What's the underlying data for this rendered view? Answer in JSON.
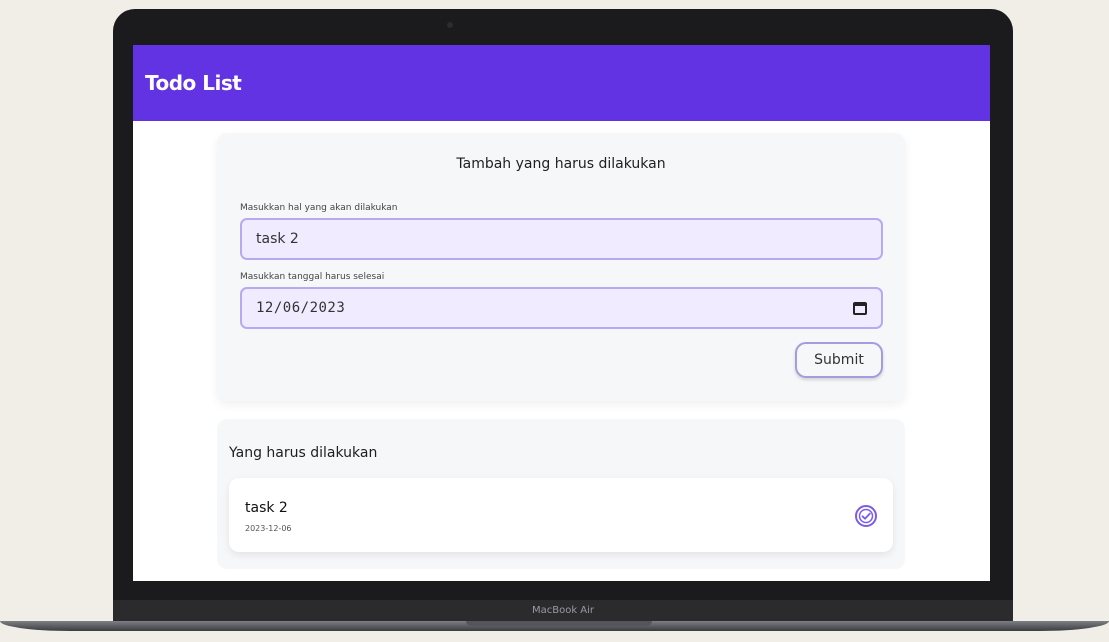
{
  "app": {
    "title": "Todo List"
  },
  "form": {
    "heading": "Tambah yang harus dilakukan",
    "task_label": "Masukkan hal yang akan dilakukan",
    "task_value": "task 2",
    "date_label": "Masukkan tanggal harus selesai",
    "date_value": "12/06/2023",
    "submit_label": "Submit"
  },
  "todo_list": {
    "heading": "Yang harus dilakukan",
    "items": [
      {
        "title": "task 2",
        "date": "2023-12-06"
      }
    ]
  },
  "device": {
    "label": "MacBook Air"
  },
  "colors": {
    "accent": "#6233e3",
    "input_border": "#b8a9f0",
    "check": "#7b5ce8"
  },
  "icons": [
    "calendar-icon",
    "check-circle-icon"
  ]
}
